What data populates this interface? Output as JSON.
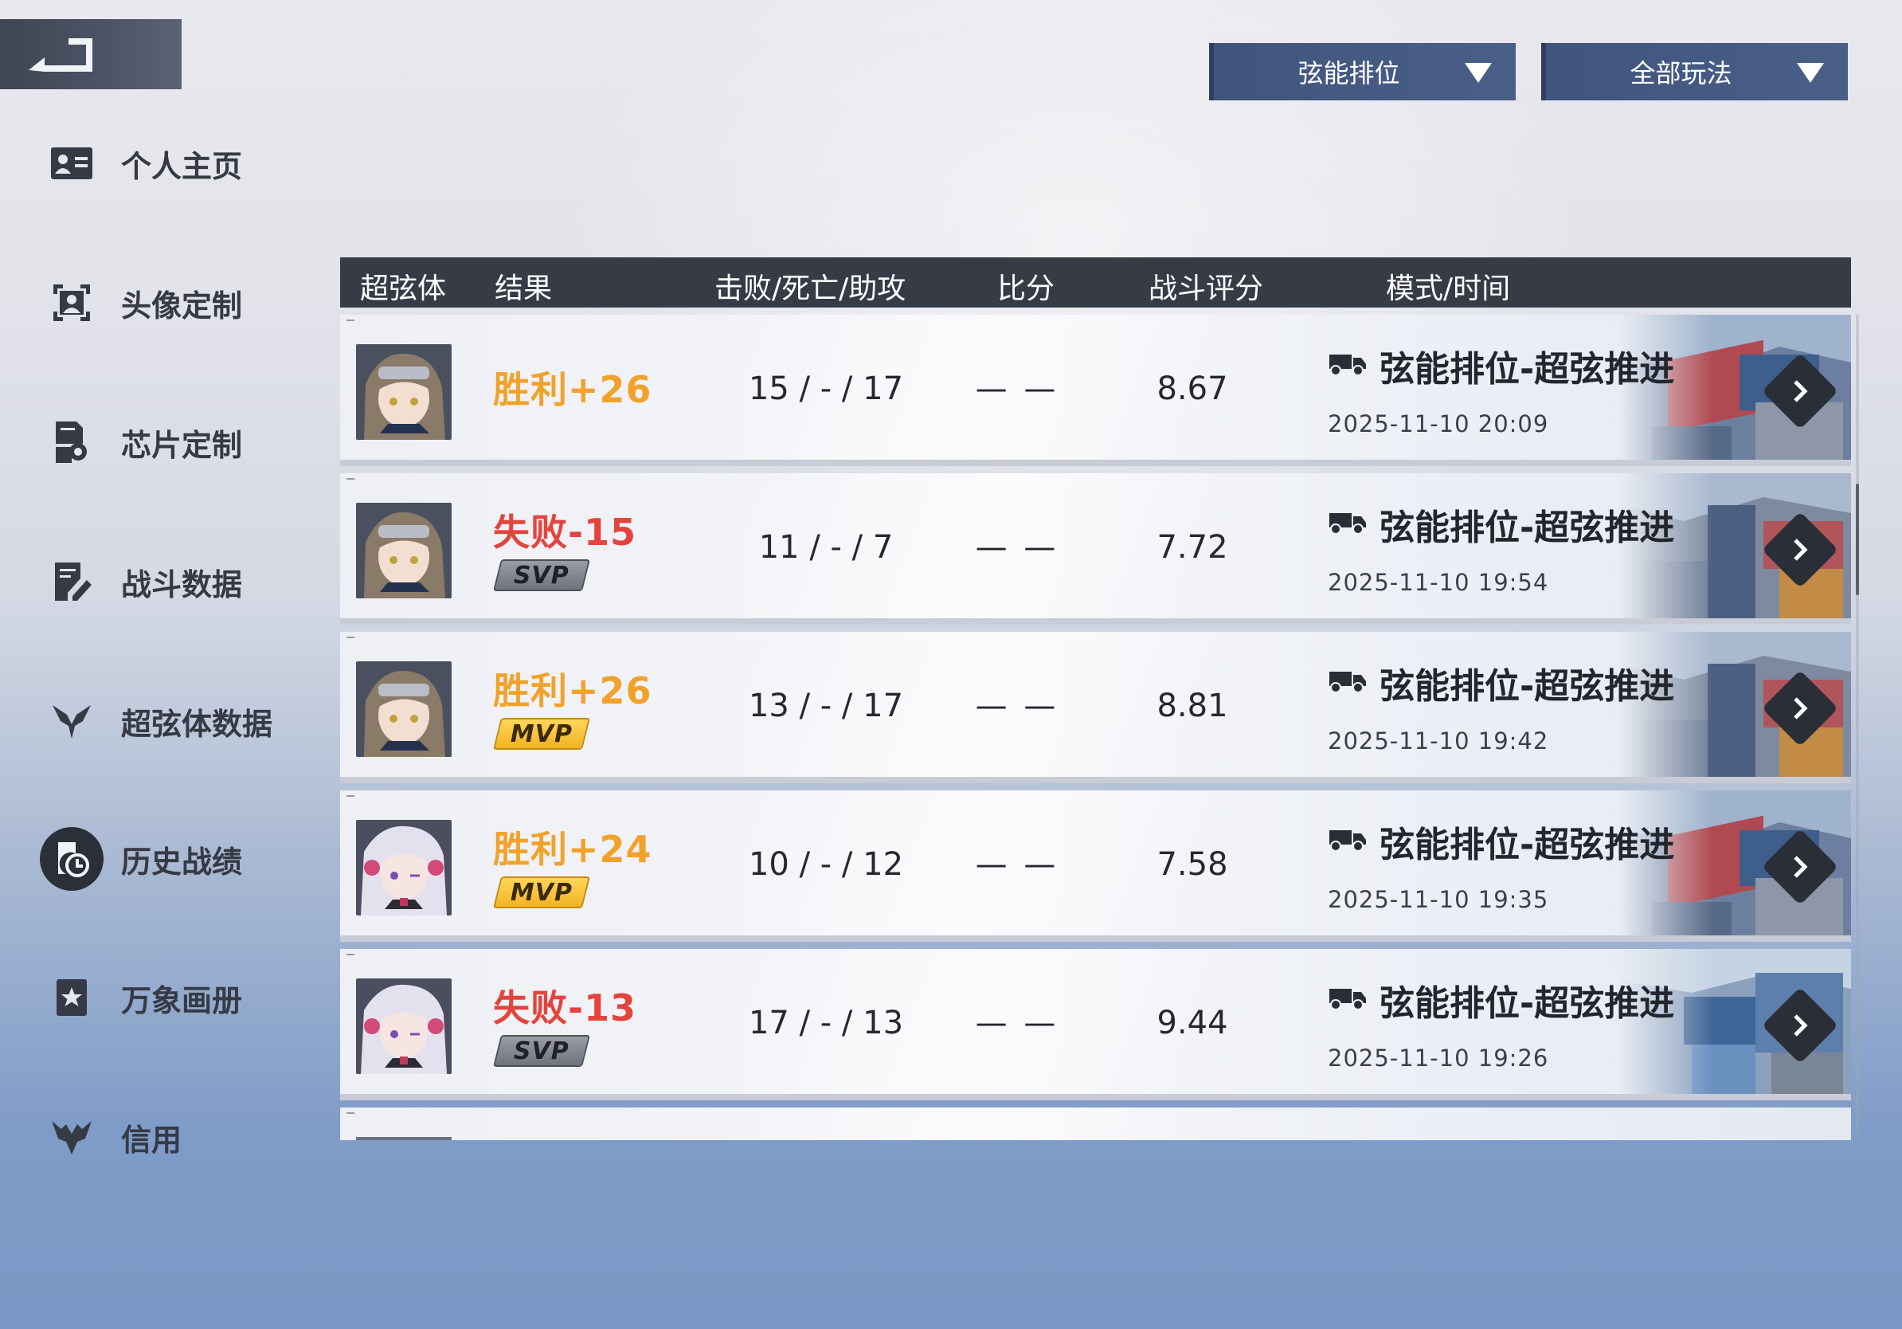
{
  "dropdowns": {
    "mode_filter": "弦能排位",
    "play_filter": "全部玩法"
  },
  "sidebar": {
    "items": [
      {
        "label": "个人主页",
        "icon": "profile-card-icon"
      },
      {
        "label": "头像定制",
        "icon": "avatar-frame-icon"
      },
      {
        "label": "芯片定制",
        "icon": "chip-gear-icon"
      },
      {
        "label": "战斗数据",
        "icon": "notepad-pen-icon"
      },
      {
        "label": "超弦体数据",
        "icon": "wing-emblem-icon"
      },
      {
        "label": "历史战绩",
        "icon": "history-clock-icon",
        "active": true
      },
      {
        "label": "万象画册",
        "icon": "star-album-icon"
      },
      {
        "label": "信用",
        "icon": "wings-badge-icon"
      }
    ]
  },
  "table": {
    "headers": {
      "character": "超弦体",
      "result": "结果",
      "kda": "击败/死亡/助攻",
      "score": "比分",
      "rating": "战斗评分",
      "mode_time": "模式/时间"
    },
    "rows": [
      {
        "avatar": "brown-hair-goggles",
        "result": "胜利+26",
        "outcome": "win",
        "badge": "",
        "kda": "15 / - / 17",
        "score": "— —",
        "rating": "8.67",
        "mode": "弦能排位-超弦推进",
        "time": "2025-11-10 20:09"
      },
      {
        "avatar": "brown-hair-goggles",
        "result": "失败-15",
        "outcome": "loss",
        "badge": "SVP",
        "kda": "11 / - / 7",
        "score": "— —",
        "rating": "7.72",
        "mode": "弦能排位-超弦推进",
        "time": "2025-11-10 19:54"
      },
      {
        "avatar": "brown-hair-goggles",
        "result": "胜利+26",
        "outcome": "win",
        "badge": "MVP",
        "kda": "13 / - / 17",
        "score": "— —",
        "rating": "8.81",
        "mode": "弦能排位-超弦推进",
        "time": "2025-11-10 19:42"
      },
      {
        "avatar": "white-hair-pink",
        "result": "胜利+24",
        "outcome": "win",
        "badge": "MVP",
        "kda": "10 / - / 12",
        "score": "— —",
        "rating": "7.58",
        "mode": "弦能排位-超弦推进",
        "time": "2025-11-10 19:35"
      },
      {
        "avatar": "white-hair-pink",
        "result": "失败-13",
        "outcome": "loss",
        "badge": "SVP",
        "kda": "17 / - / 13",
        "score": "— —",
        "rating": "9.44",
        "mode": "弦能排位-超弦推进",
        "time": "2025-11-10 19:26"
      }
    ]
  },
  "colors": {
    "win": "#f2a22a",
    "loss": "#e3453e",
    "header_bg": "#363b46",
    "dropdown_bg": "#40557e"
  }
}
